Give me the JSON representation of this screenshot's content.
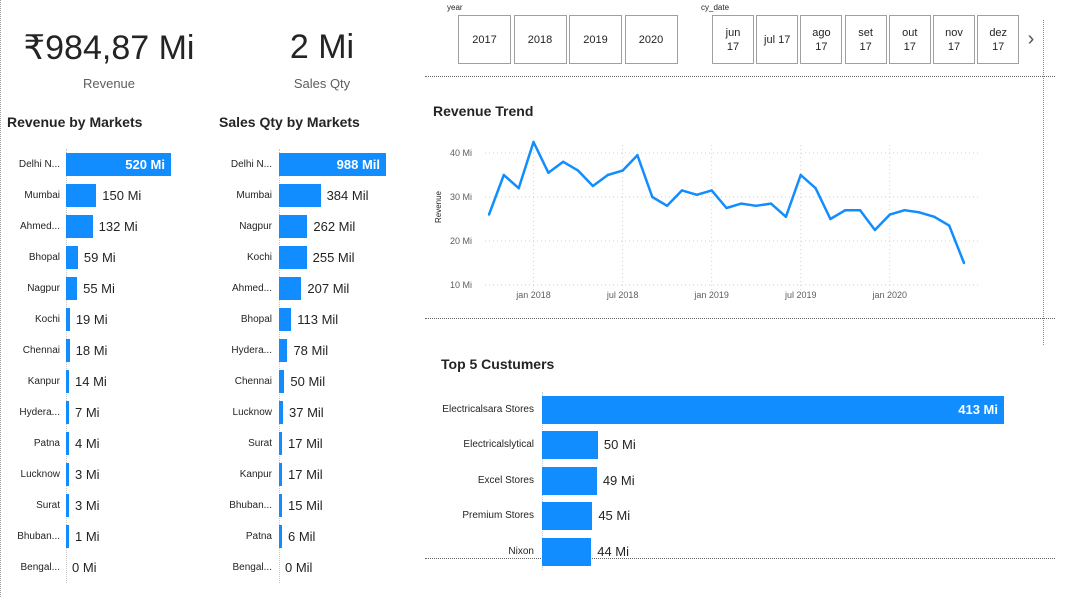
{
  "kpis": {
    "revenue": {
      "value": "₹984,87 Mi",
      "label": "Revenue"
    },
    "sales_qty": {
      "value": "2 Mi",
      "label": "Sales Qty"
    }
  },
  "revenue_by_markets": {
    "title": "Revenue by Markets",
    "rows": [
      {
        "label": "Delhi N...",
        "value": 520,
        "text": "520 Mi"
      },
      {
        "label": "Mumbai",
        "value": 150,
        "text": "150 Mi"
      },
      {
        "label": "Ahmed...",
        "value": 132,
        "text": "132 Mi"
      },
      {
        "label": "Bhopal",
        "value": 59,
        "text": "59 Mi"
      },
      {
        "label": "Nagpur",
        "value": 55,
        "text": "55 Mi"
      },
      {
        "label": "Kochi",
        "value": 19,
        "text": "19 Mi"
      },
      {
        "label": "Chennai",
        "value": 18,
        "text": "18 Mi"
      },
      {
        "label": "Kanpur",
        "value": 14,
        "text": "14 Mi"
      },
      {
        "label": "Hydera...",
        "value": 7,
        "text": "7 Mi"
      },
      {
        "label": "Patna",
        "value": 4,
        "text": "4 Mi"
      },
      {
        "label": "Lucknow",
        "value": 3,
        "text": "3 Mi"
      },
      {
        "label": "Surat",
        "value": 3,
        "text": "3 Mi"
      },
      {
        "label": "Bhuban...",
        "value": 1,
        "text": "1 Mi"
      },
      {
        "label": "Bengal...",
        "value": 0,
        "text": "0 Mi"
      }
    ]
  },
  "sales_qty_by_markets": {
    "title": "Sales Qty by Markets",
    "rows": [
      {
        "label": "Delhi N...",
        "value": 988,
        "text": "988 Mil"
      },
      {
        "label": "Mumbai",
        "value": 384,
        "text": "384 Mil"
      },
      {
        "label": "Nagpur",
        "value": 262,
        "text": "262 Mil"
      },
      {
        "label": "Kochi",
        "value": 255,
        "text": "255 Mil"
      },
      {
        "label": "Ahmed...",
        "value": 207,
        "text": "207 Mil"
      },
      {
        "label": "Bhopal",
        "value": 113,
        "text": "113 Mil"
      },
      {
        "label": "Hydera...",
        "value": 78,
        "text": "78 Mil"
      },
      {
        "label": "Chennai",
        "value": 50,
        "text": "50 Mil"
      },
      {
        "label": "Lucknow",
        "value": 37,
        "text": "37 Mil"
      },
      {
        "label": "Surat",
        "value": 17,
        "text": "17 Mil"
      },
      {
        "label": "Kanpur",
        "value": 17,
        "text": "17 Mil"
      },
      {
        "label": "Bhuban...",
        "value": 15,
        "text": "15 Mil"
      },
      {
        "label": "Patna",
        "value": 6,
        "text": "6 Mil"
      },
      {
        "label": "Bengal...",
        "value": 0,
        "text": "0 Mil"
      }
    ]
  },
  "year_slicer": {
    "label": "year",
    "options": [
      "2017",
      "2018",
      "2019",
      "2020"
    ]
  },
  "date_slicer": {
    "label": "cy_date",
    "options": [
      {
        "month": "jun",
        "year": "17"
      },
      {
        "month": "jul 17",
        "year": ""
      },
      {
        "month": "ago",
        "year": "17"
      },
      {
        "month": "set",
        "year": "17"
      },
      {
        "month": "out",
        "year": "17"
      },
      {
        "month": "nov",
        "year": "17"
      },
      {
        "month": "dez",
        "year": "17"
      }
    ],
    "next_glyph": "›"
  },
  "revenue_trend": {
    "title": "Revenue Trend",
    "y_axis_title": "Revenue",
    "y_ticks": [
      "40 Mi",
      "30 Mi",
      "20 Mi",
      "10 Mi"
    ],
    "x_ticks": [
      "jan 2018",
      "jul 2018",
      "jan 2019",
      "jul 2019",
      "jan 2020"
    ]
  },
  "top_customers": {
    "title": "Top 5 Custumers",
    "rows": [
      {
        "label": "Electricalsara Stores",
        "value": 413,
        "text": "413 Mi"
      },
      {
        "label": "Electricalslytical",
        "value": 50,
        "text": "50 Mi"
      },
      {
        "label": "Excel Stores",
        "value": 49,
        "text": "49 Mi"
      },
      {
        "label": "Premium Stores",
        "value": 45,
        "text": "45 Mi"
      },
      {
        "label": "Nixon",
        "value": 44,
        "text": "44 Mi"
      }
    ]
  },
  "colors": {
    "accent": "#118dff"
  },
  "chart_data": [
    {
      "type": "bar",
      "title": "Revenue by Markets",
      "categories": [
        "Delhi N...",
        "Mumbai",
        "Ahmed...",
        "Bhopal",
        "Nagpur",
        "Kochi",
        "Chennai",
        "Kanpur",
        "Hydera...",
        "Patna",
        "Lucknow",
        "Surat",
        "Bhuban...",
        "Bengal..."
      ],
      "values": [
        520,
        150,
        132,
        59,
        55,
        19,
        18,
        14,
        7,
        4,
        3,
        3,
        1,
        0
      ],
      "unit": "Mi"
    },
    {
      "type": "bar",
      "title": "Sales Qty by Markets",
      "categories": [
        "Delhi N...",
        "Mumbai",
        "Nagpur",
        "Kochi",
        "Ahmed...",
        "Bhopal",
        "Hydera...",
        "Chennai",
        "Lucknow",
        "Surat",
        "Kanpur",
        "Bhuban...",
        "Patna",
        "Bengal..."
      ],
      "values": [
        988,
        384,
        262,
        255,
        207,
        113,
        78,
        50,
        37,
        17,
        17,
        15,
        6,
        0
      ],
      "unit": "Mil"
    },
    {
      "type": "line",
      "title": "Revenue Trend",
      "ylabel": "Revenue",
      "ylim": [
        10,
        40
      ],
      "x": [
        "2017-10",
        "2017-11",
        "2017-12",
        "2018-01",
        "2018-02",
        "2018-03",
        "2018-04",
        "2018-05",
        "2018-06",
        "2018-07",
        "2018-08",
        "2018-09",
        "2018-10",
        "2018-11",
        "2018-12",
        "2019-01",
        "2019-02",
        "2019-03",
        "2019-04",
        "2019-05",
        "2019-06",
        "2019-07",
        "2019-08",
        "2019-09",
        "2019-10",
        "2019-11",
        "2019-12",
        "2020-01",
        "2020-02",
        "2020-03",
        "2020-04",
        "2020-05",
        "2020-06"
      ],
      "series": [
        {
          "values": [
            26,
            35,
            32,
            42.5,
            35.5,
            38,
            36,
            32.5,
            35,
            36,
            39.5,
            30,
            28,
            31.5,
            30.5,
            31.5,
            27.5,
            28.5,
            28,
            28.5,
            25.5,
            35,
            32,
            25,
            27,
            27,
            22.5,
            26,
            27,
            26.5,
            25.5,
            23.5,
            15
          ]
        }
      ],
      "grid": true
    },
    {
      "type": "bar",
      "title": "Top 5 Custumers",
      "categories": [
        "Electricalsara Stores",
        "Electricalslytical",
        "Excel Stores",
        "Premium Stores",
        "Nixon"
      ],
      "values": [
        413,
        50,
        49,
        45,
        44
      ],
      "unit": "Mi"
    }
  ]
}
